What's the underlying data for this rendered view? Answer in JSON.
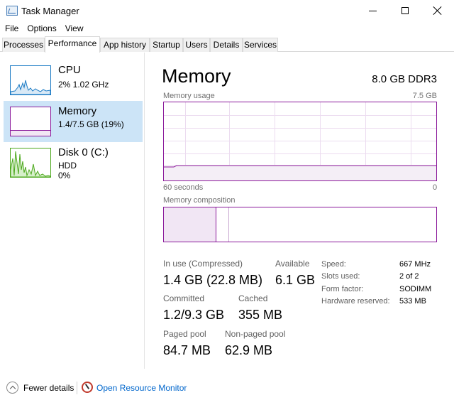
{
  "window": {
    "title": "Task Manager"
  },
  "menu": [
    "File",
    "Options",
    "View"
  ],
  "tabs": [
    {
      "label": "Processes",
      "active": false
    },
    {
      "label": "Performance",
      "active": true
    },
    {
      "label": "App history",
      "active": false
    },
    {
      "label": "Startup",
      "active": false
    },
    {
      "label": "Users",
      "active": false
    },
    {
      "label": "Details",
      "active": false
    },
    {
      "label": "Services",
      "active": false
    }
  ],
  "sidebar": {
    "items": [
      {
        "name": "CPU",
        "line1": "2%  1.02 GHz",
        "line2": "",
        "color": "#1a7ac4",
        "selected": false
      },
      {
        "name": "Memory",
        "line1": "1.4/7.5 GB (19%)",
        "line2": "",
        "color": "#8b1a9b",
        "selected": true
      },
      {
        "name": "Disk 0 (C:)",
        "line1": "HDD",
        "line2": "0%",
        "color": "#4ca81c",
        "selected": false
      }
    ]
  },
  "main": {
    "title": "Memory",
    "spec": "8.0 GB DDR3",
    "usage_label": "Memory usage",
    "usage_max": "7.5 GB",
    "time_left": "60 seconds",
    "time_right": "0",
    "usage_fraction": 0.19,
    "composition_label": "Memory composition",
    "stats": {
      "in_use_label": "In use (Compressed)",
      "in_use_value": "1.4 GB (22.8 MB)",
      "available_label": "Available",
      "available_value": "6.1 GB",
      "committed_label": "Committed",
      "committed_value": "1.2/9.3 GB",
      "cached_label": "Cached",
      "cached_value": "355 MB",
      "paged_label": "Paged pool",
      "paged_value": "84.7 MB",
      "nonpaged_label": "Non-paged pool",
      "nonpaged_value": "62.9 MB"
    },
    "specs": [
      {
        "label": "Speed:",
        "value": "667 MHz"
      },
      {
        "label": "Slots used:",
        "value": "2 of 2"
      },
      {
        "label": "Form factor:",
        "value": "SODIMM"
      },
      {
        "label": "Hardware reserved:",
        "value": "533 MB"
      }
    ]
  },
  "footer": {
    "fewer_details": "Fewer details",
    "resource_monitor": "Open Resource Monitor"
  },
  "colors": {
    "memory": "#8b1a9b",
    "memory_fill": "#f4eef6",
    "cpu": "#1a7ac4",
    "disk": "#4ca81c",
    "selected_bg": "#cce4f7"
  }
}
